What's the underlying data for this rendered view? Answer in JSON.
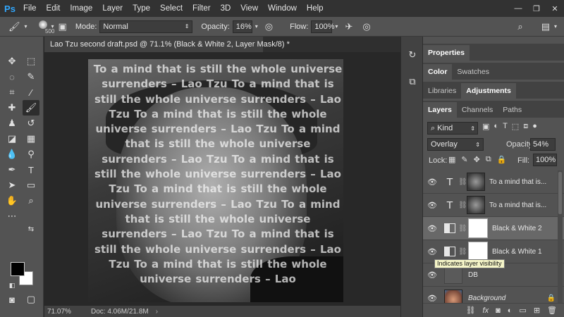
{
  "menubar": {
    "logo": "Ps",
    "items": [
      "File",
      "Edit",
      "Image",
      "Layer",
      "Type",
      "Select",
      "Filter",
      "3D",
      "View",
      "Window",
      "Help"
    ],
    "window_controls": [
      "—",
      "❐",
      "✕"
    ]
  },
  "options": {
    "brush_size": "500",
    "mode_label": "Mode:",
    "mode_value": "Normal",
    "opacity_label": "Opacity:",
    "opacity_value": "16%",
    "flow_label": "Flow:",
    "flow_value": "100%"
  },
  "document": {
    "tab_title": "Lao Tzu second draft.psd @ 71.1% (Black & White 2, Layer Mask/8) *",
    "canvas_text": "To a mind that is still the whole universe surrenders – Lao Tzu  To a mind that is still the whole universe surrenders – Lao Tzu  To a mind that is still the whole universe surrenders – Lao Tzu  To a mind that is still the whole universe surrenders – Lao Tzu  To a mind that is still the whole universe surrenders – Lao Tzu  To a mind that is still the whole universe surrenders – Lao Tzu  To a mind that is still the whole universe surrenders – Lao Tzu  To a mind that is still the whole universe surrenders – Lao Tzu  To a mind that is still the whole universe surrenders – Lao"
  },
  "status": {
    "zoom": "71.07%",
    "doc_info": "Doc: 4.06M/21.8M",
    "arrow": "›"
  },
  "panels": {
    "properties_tab": "Properties",
    "color_tab": "Color",
    "swatches_tab": "Swatches",
    "libraries_tab": "Libraries",
    "adjustments_tab": "Adjustments",
    "layers_tab": "Layers",
    "channels_tab": "Channels",
    "paths_tab": "Paths"
  },
  "layers_panel": {
    "kind_label": "Kind",
    "blend_mode": "Overlay",
    "opacity_label": "Opacity:",
    "opacity_value": "54%",
    "lock_label": "Lock:",
    "fill_label": "Fill:",
    "fill_value": "100%",
    "layers": [
      {
        "name": "To a mind that is..."
      },
      {
        "name": "To a mind that is..."
      },
      {
        "name": "Black & White 2"
      },
      {
        "name": "Black & White 1"
      },
      {
        "name": "DB"
      },
      {
        "name": "Background"
      }
    ],
    "tooltip": "Indicates layer visibility"
  }
}
